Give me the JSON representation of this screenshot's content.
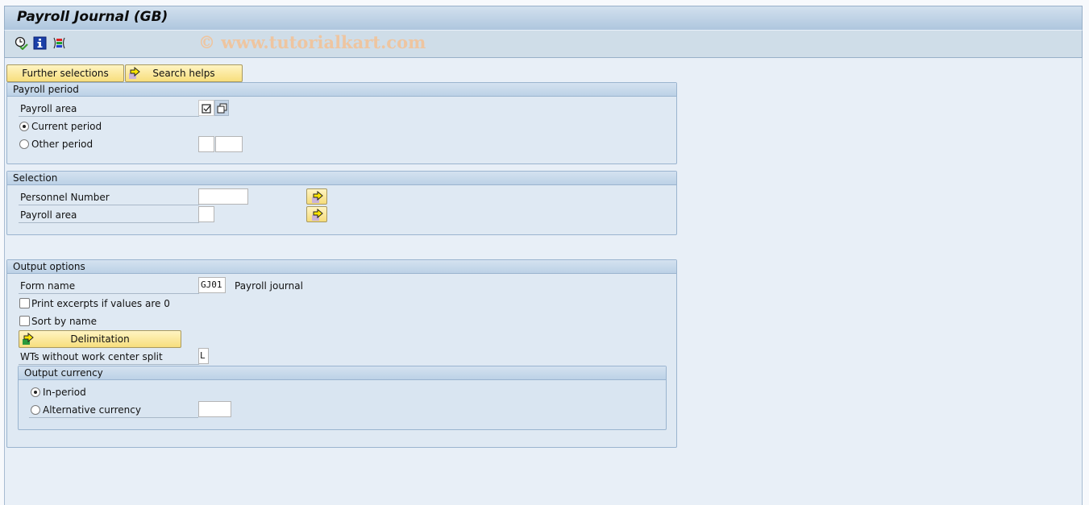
{
  "window": {
    "title": "Payroll Journal (GB)",
    "watermark": "© www.tutorialkart.com"
  },
  "toolbar": {
    "icons": [
      "execute-clock-icon",
      "info-icon",
      "selection-options-icon"
    ]
  },
  "buttons": {
    "further_selections": "Further selections",
    "search_helps": "Search helps"
  },
  "payroll_period": {
    "header": "Payroll period",
    "payroll_area_label": "Payroll area",
    "current_period_label": "Current period",
    "current_period_selected": true,
    "other_period_label": "Other period",
    "other_period_selected": false,
    "other_period_value_1": "",
    "other_period_value_2": ""
  },
  "selection": {
    "header": "Selection",
    "personnel_number_label": "Personnel Number",
    "personnel_number_value": "",
    "payroll_area_label": "Payroll area",
    "payroll_area_value": ""
  },
  "output_options": {
    "header": "Output options",
    "form_name_label": "Form name",
    "form_name_value": "GJ01",
    "form_name_desc": "Payroll journal",
    "print_excerpts_label": "Print excerpts if values are 0",
    "print_excerpts_checked": false,
    "sort_by_name_label": "Sort by name",
    "sort_by_name_checked": false,
    "delimitation_label": "Delimitation",
    "wts_label": "WTs without work center split",
    "wts_value": "L",
    "output_currency": {
      "header": "Output currency",
      "in_period_label": "In-period",
      "in_period_selected": true,
      "alternative_label": "Alternative currency",
      "alternative_selected": false,
      "alternative_value": ""
    }
  }
}
